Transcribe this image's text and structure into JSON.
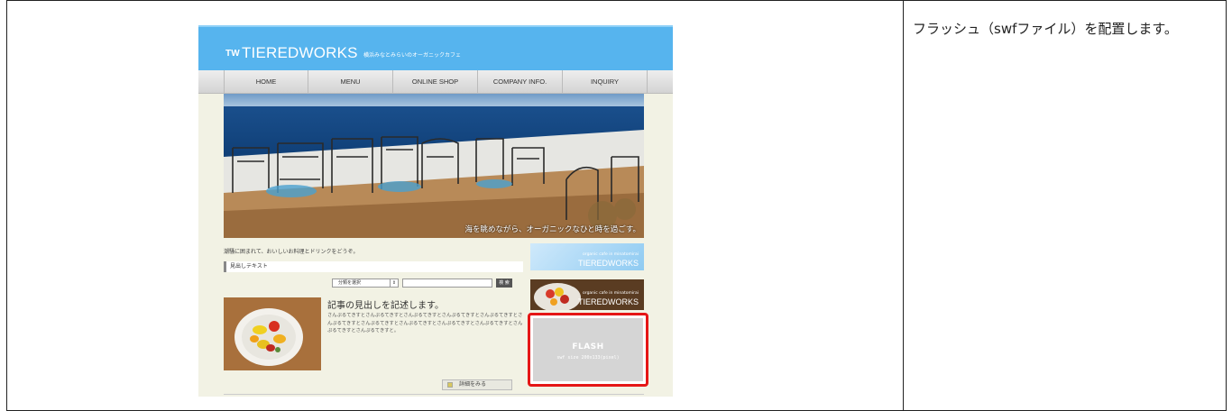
{
  "description_text": "フラッシュ（swfファイル）を配置します。",
  "site": {
    "logo_mark": "TW",
    "logo": "TIEREDWORKS",
    "tagline": "横浜みなとみらいのオーガニックカフェ",
    "nav": [
      "HOME",
      "MENU",
      "ONLINE SHOP",
      "COMPANY INFO.",
      "INQUIRY"
    ],
    "hero_caption": "海を眺めながら、オーガニックなひと時を過ごす。",
    "intro": "潮騒に囲まれて、おいしいお料理とドリンクをどうぞ。",
    "heading": "見出しテキスト",
    "select_value": "分類を選択",
    "search_button": "検 索",
    "banner_sub": "organic cafe in minatomirai",
    "banner_main": "TIEREDWORKS",
    "article_title": "記事の見出しを記述します。",
    "article_body": "さんぷるてきすとさんぷるてきすとさんぷるてきすとさんぷるてきすとさんぷるてきすとさんぷるてきすとさんぷるてきすとさんぷるてきすとさんぷるてきすとさんぷるてきすとさんぷるてきすとさんぷるてきすと。",
    "more_button": "詳細をみる",
    "flash_title": "FLASH",
    "flash_sub": "swf size 200x133(pixel)"
  },
  "colors": {
    "header_blue": "#56b4ee",
    "flash_highlight": "#e51616"
  }
}
